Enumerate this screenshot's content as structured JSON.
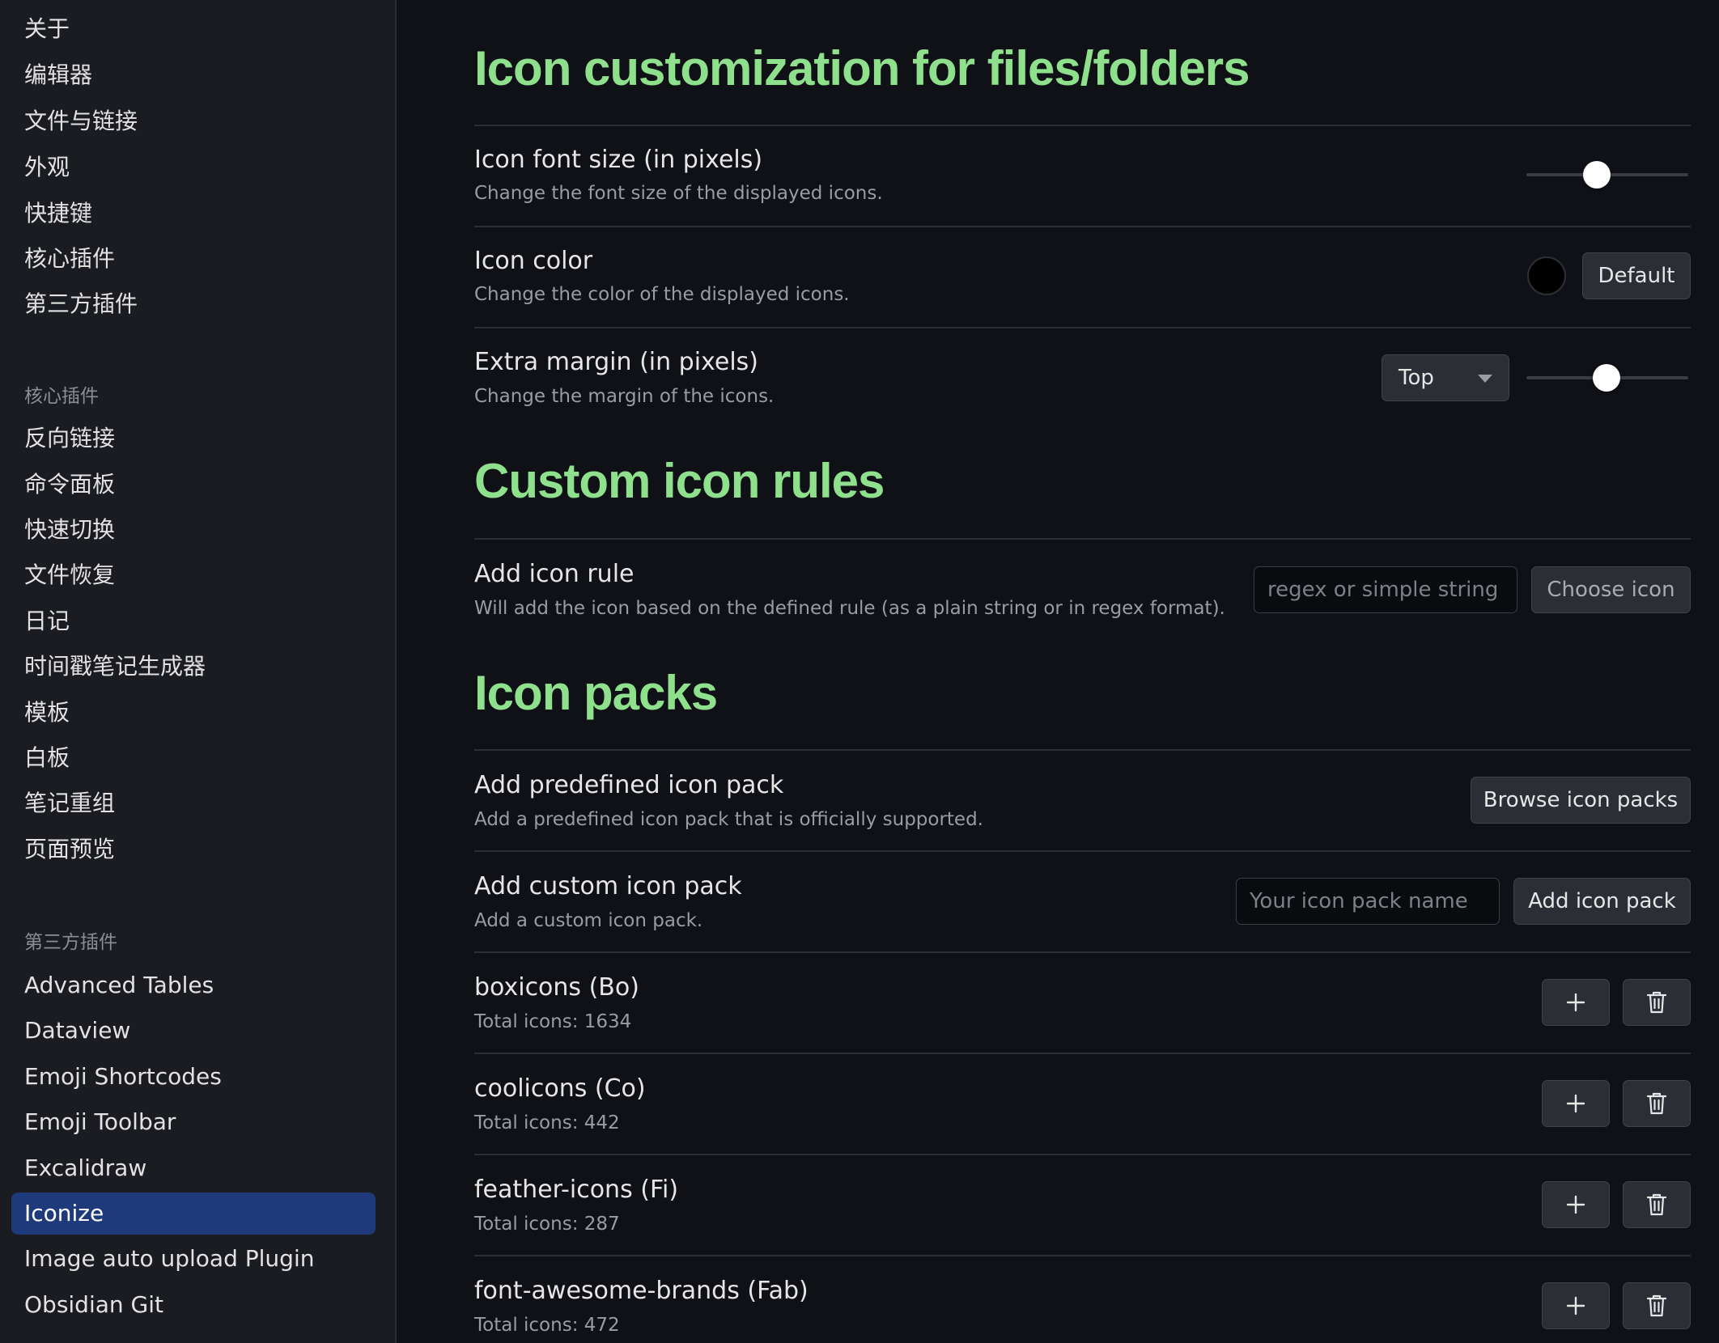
{
  "sidebar": {
    "top_items": [
      {
        "label": "关于"
      },
      {
        "label": "编辑器"
      },
      {
        "label": "文件与链接"
      },
      {
        "label": "外观"
      },
      {
        "label": "快捷键"
      },
      {
        "label": "核心插件"
      },
      {
        "label": "第三方插件"
      }
    ],
    "core_group_label": "核心插件",
    "core_items": [
      {
        "label": "反向链接"
      },
      {
        "label": "命令面板"
      },
      {
        "label": "快速切换"
      },
      {
        "label": "文件恢复"
      },
      {
        "label": "日记"
      },
      {
        "label": "时间戳笔记生成器"
      },
      {
        "label": "模板"
      },
      {
        "label": "白板"
      },
      {
        "label": "笔记重组"
      },
      {
        "label": "页面预览"
      }
    ],
    "community_group_label": "第三方插件",
    "community_items": [
      {
        "label": "Advanced Tables"
      },
      {
        "label": "Dataview"
      },
      {
        "label": "Emoji Shortcodes"
      },
      {
        "label": "Emoji Toolbar"
      },
      {
        "label": "Excalidraw"
      },
      {
        "label": "Iconize"
      },
      {
        "label": "Image auto upload Plugin"
      },
      {
        "label": "Obsidian Git"
      }
    ]
  },
  "section_customization": {
    "title": "Icon customization for files/folders",
    "font_size": {
      "name": "Icon font size (in pixels)",
      "desc": "Change the font size of the displayed icons.",
      "slider_level": 0.44
    },
    "color": {
      "name": "Icon color",
      "desc": "Change the color of the displayed icons.",
      "swatch_color": "#000000",
      "default_label": "Default"
    },
    "margin": {
      "name": "Extra margin (in pixels)",
      "desc": "Change the margin of the icons.",
      "dropdown_value": "Top",
      "slider_level": 0.5
    }
  },
  "section_rules": {
    "title": "Custom icon rules",
    "add_rule": {
      "name": "Add icon rule",
      "desc": "Will add the icon based on the defined rule (as a plain string or in regex format).",
      "input_placeholder": "regex or simple string",
      "choose_label": "Choose icon"
    }
  },
  "section_packs": {
    "title": "Icon packs",
    "predefined": {
      "name": "Add predefined icon pack",
      "desc": "Add a predefined icon pack that is officially supported.",
      "button_label": "Browse icon packs"
    },
    "custom": {
      "name": "Add custom icon pack",
      "desc": "Add a custom icon pack.",
      "input_placeholder": "Your icon pack name",
      "button_label": "Add icon pack"
    },
    "packs": [
      {
        "name": "boxicons (Bo)",
        "desc": "Total icons: 1634"
      },
      {
        "name": "coolicons (Co)",
        "desc": "Total icons: 442"
      },
      {
        "name": "feather-icons (Fi)",
        "desc": "Total icons: 287"
      },
      {
        "name": "font-awesome-brands (Fab)",
        "desc": "Total icons: 472"
      }
    ]
  },
  "colors": {
    "accent_heading": "#8fe08c",
    "active_item_bg": "#1e3a7a",
    "background": "#0f1117",
    "sidebar_bg": "#1a1c22"
  }
}
